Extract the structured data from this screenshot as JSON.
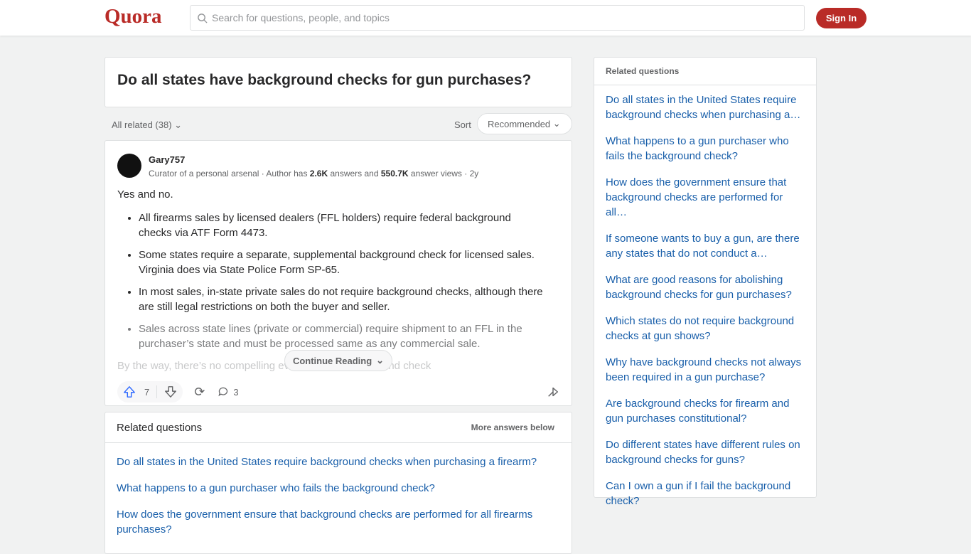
{
  "header": {
    "logo": "Quora",
    "search_placeholder": "Search for questions, people, and topics",
    "signin": "Sign In"
  },
  "question": {
    "title": "Do all states have background checks for gun purchases?"
  },
  "filter": {
    "all_related": "All related (38)",
    "sort_label": "Sort",
    "sort_value": "Recommended"
  },
  "answer": {
    "author": "Gary757",
    "cred_prefix": "Curator of a personal arsenal · Author has ",
    "answers": "2.6K",
    "cred_mid": " answers and ",
    "views": "550.7K",
    "cred_suffix": " answer views · 2y",
    "intro": "Yes and no.",
    "bullets": [
      "All firearms sales by licensed dealers (FFL holders) require federal background checks via ATF Form 4473.",
      "Some states require a separate, supplemental background check for licensed sales. Virginia does via State Police Form SP-65.",
      "In most sales, in-state private sales do not require background checks, although there are still legal restrictions on both the buyer and seller.",
      "Sales across state lines (private or commercial) require shipment to an FFL in the purchaser’s state and must be processed same as any commercial sale."
    ],
    "faded": "By the way, there’s no compelling evidence that background check",
    "continue": "Continue Reading",
    "upvotes": "7",
    "comments": "3"
  },
  "related_main": {
    "title": "Related questions",
    "more": "More answers below",
    "items": [
      "Do all states in the United States require background checks when purchasing a firearm?",
      "What happens to a gun purchaser who fails the background check?",
      "How does the government ensure that background checks are performed for all firearms purchases?"
    ]
  },
  "related_side": {
    "title": "Related questions",
    "items": [
      "Do all states in the United States require background checks when purchasing a…",
      "What happens to a gun purchaser who fails the background check?",
      "How does the government ensure that background checks are performed for all…",
      "If someone wants to buy a gun, are there any states that do not conduct a…",
      "What are good reasons for abolishing background checks for gun purchases?",
      "Which states do not require background checks at gun shows?",
      "Why have background checks not always been required in a gun purchase?",
      "Are background checks for firearm and gun purchases constitutional?",
      "Do different states have different rules on background checks for guns?",
      "Can I own a gun if I fail the background check?"
    ]
  }
}
